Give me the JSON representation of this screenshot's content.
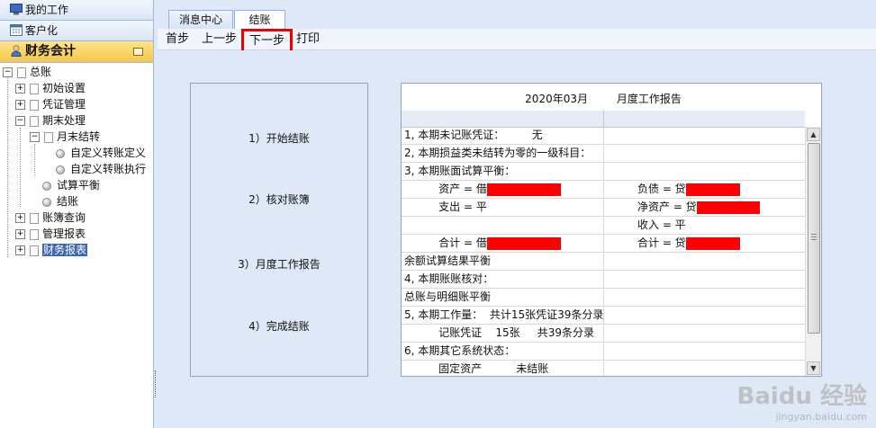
{
  "sidebar": {
    "sections": [
      {
        "label": "我的工作"
      },
      {
        "label": "客户化"
      },
      {
        "label": "财务会计"
      }
    ],
    "tree": {
      "root": "总账",
      "items": [
        "初始设置",
        "凭证管理",
        "期末处理",
        "月末结转",
        "自定义转账定义",
        "自定义转账执行",
        "试算平衡",
        "结账",
        "账簿查询",
        "管理报表",
        "财务报表"
      ]
    }
  },
  "tabs": [
    {
      "label": "消息中心"
    },
    {
      "label": "结账"
    }
  ],
  "toolbar": {
    "first": "首步",
    "prev": "上一步",
    "next": "下一步",
    "print": "打印"
  },
  "steps": [
    "1）开始结账",
    "2）核对账簿",
    "3）月度工作报告",
    "4）完成结账"
  ],
  "report": {
    "period": "2020年03月",
    "title": "月度工作报告",
    "rows": [
      {
        "a": "1, 本期未记账凭证：        无",
        "b": ""
      },
      {
        "a": "2, 本期损益类未结转为零的一级科目：",
        "b": ""
      },
      {
        "a": "3, 本期账面试算平衡：",
        "b": ""
      },
      {
        "a": "          资产 = 借",
        "b": "负债 = 贷",
        "ra": true,
        "rb": true
      },
      {
        "a": "          支出 = 平",
        "b": "净资产 = 贷",
        "rb": true,
        "partial": "0,2,3,0,4,5,5,4"
      },
      {
        "a": "",
        "b": "收入 = 平"
      },
      {
        "a": "          合计 = 借",
        "b": "合计 = 贷",
        "ra": true,
        "rb": true
      },
      {
        "a": "余额试算结果平衡",
        "b": ""
      },
      {
        "a": "4, 本期账账核对：",
        "b": ""
      },
      {
        "a": "总账与明细账平衡",
        "b": ""
      },
      {
        "a": "5, 本期工作量：  共计15张凭证39条分录",
        "b": ""
      },
      {
        "a": "          记账凭证    15张     共39条分录",
        "b": ""
      },
      {
        "a": "6, 本期其它系统状态：",
        "b": ""
      },
      {
        "a": "          固定资产          未结账",
        "b": ""
      }
    ]
  },
  "watermark": {
    "main": "Baidu 经验",
    "sub": "jingyan.baidu.com"
  }
}
